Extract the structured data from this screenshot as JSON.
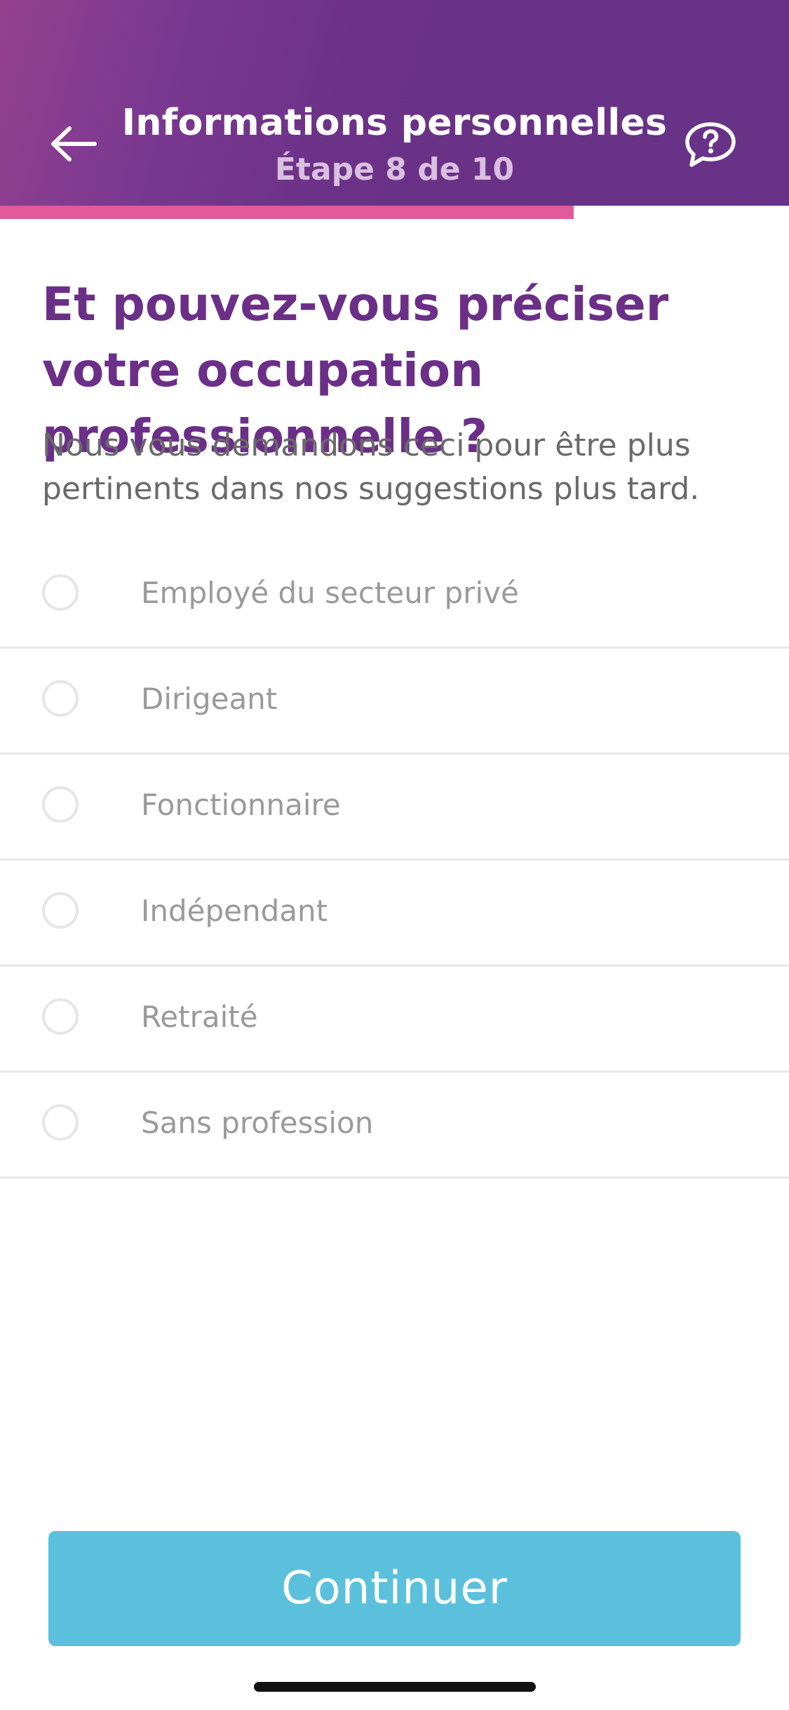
{
  "header": {
    "title": "Informations personnelles",
    "subtitle": "Étape 8 de 10",
    "back_icon": "arrow-left-icon",
    "help_icon": "speech-bubble-question-icon"
  },
  "progress": {
    "step": 8,
    "total": 10,
    "fraction": 0.727,
    "color": "#e05a9c"
  },
  "question": {
    "title": "Et pouvez-vous préciser votre occupation professionnelle ?",
    "description": "Nous vous demandons ceci pour être plus pertinents dans nos suggestions plus tard."
  },
  "options": [
    {
      "label": "Employé du secteur privé",
      "selected": false
    },
    {
      "label": "Dirigeant",
      "selected": false
    },
    {
      "label": "Fonctionnaire",
      "selected": false
    },
    {
      "label": "Indépendant",
      "selected": false
    },
    {
      "label": "Retraité",
      "selected": false
    },
    {
      "label": "Sans profession",
      "selected": false
    }
  ],
  "continue_button": {
    "label": "Continuer",
    "color": "#5bc0dc"
  },
  "colors": {
    "header_gradient_start": "#93418f",
    "header_gradient_end": "#673287",
    "question_title": "#6b2f88",
    "accent_pink": "#e05a9c"
  }
}
